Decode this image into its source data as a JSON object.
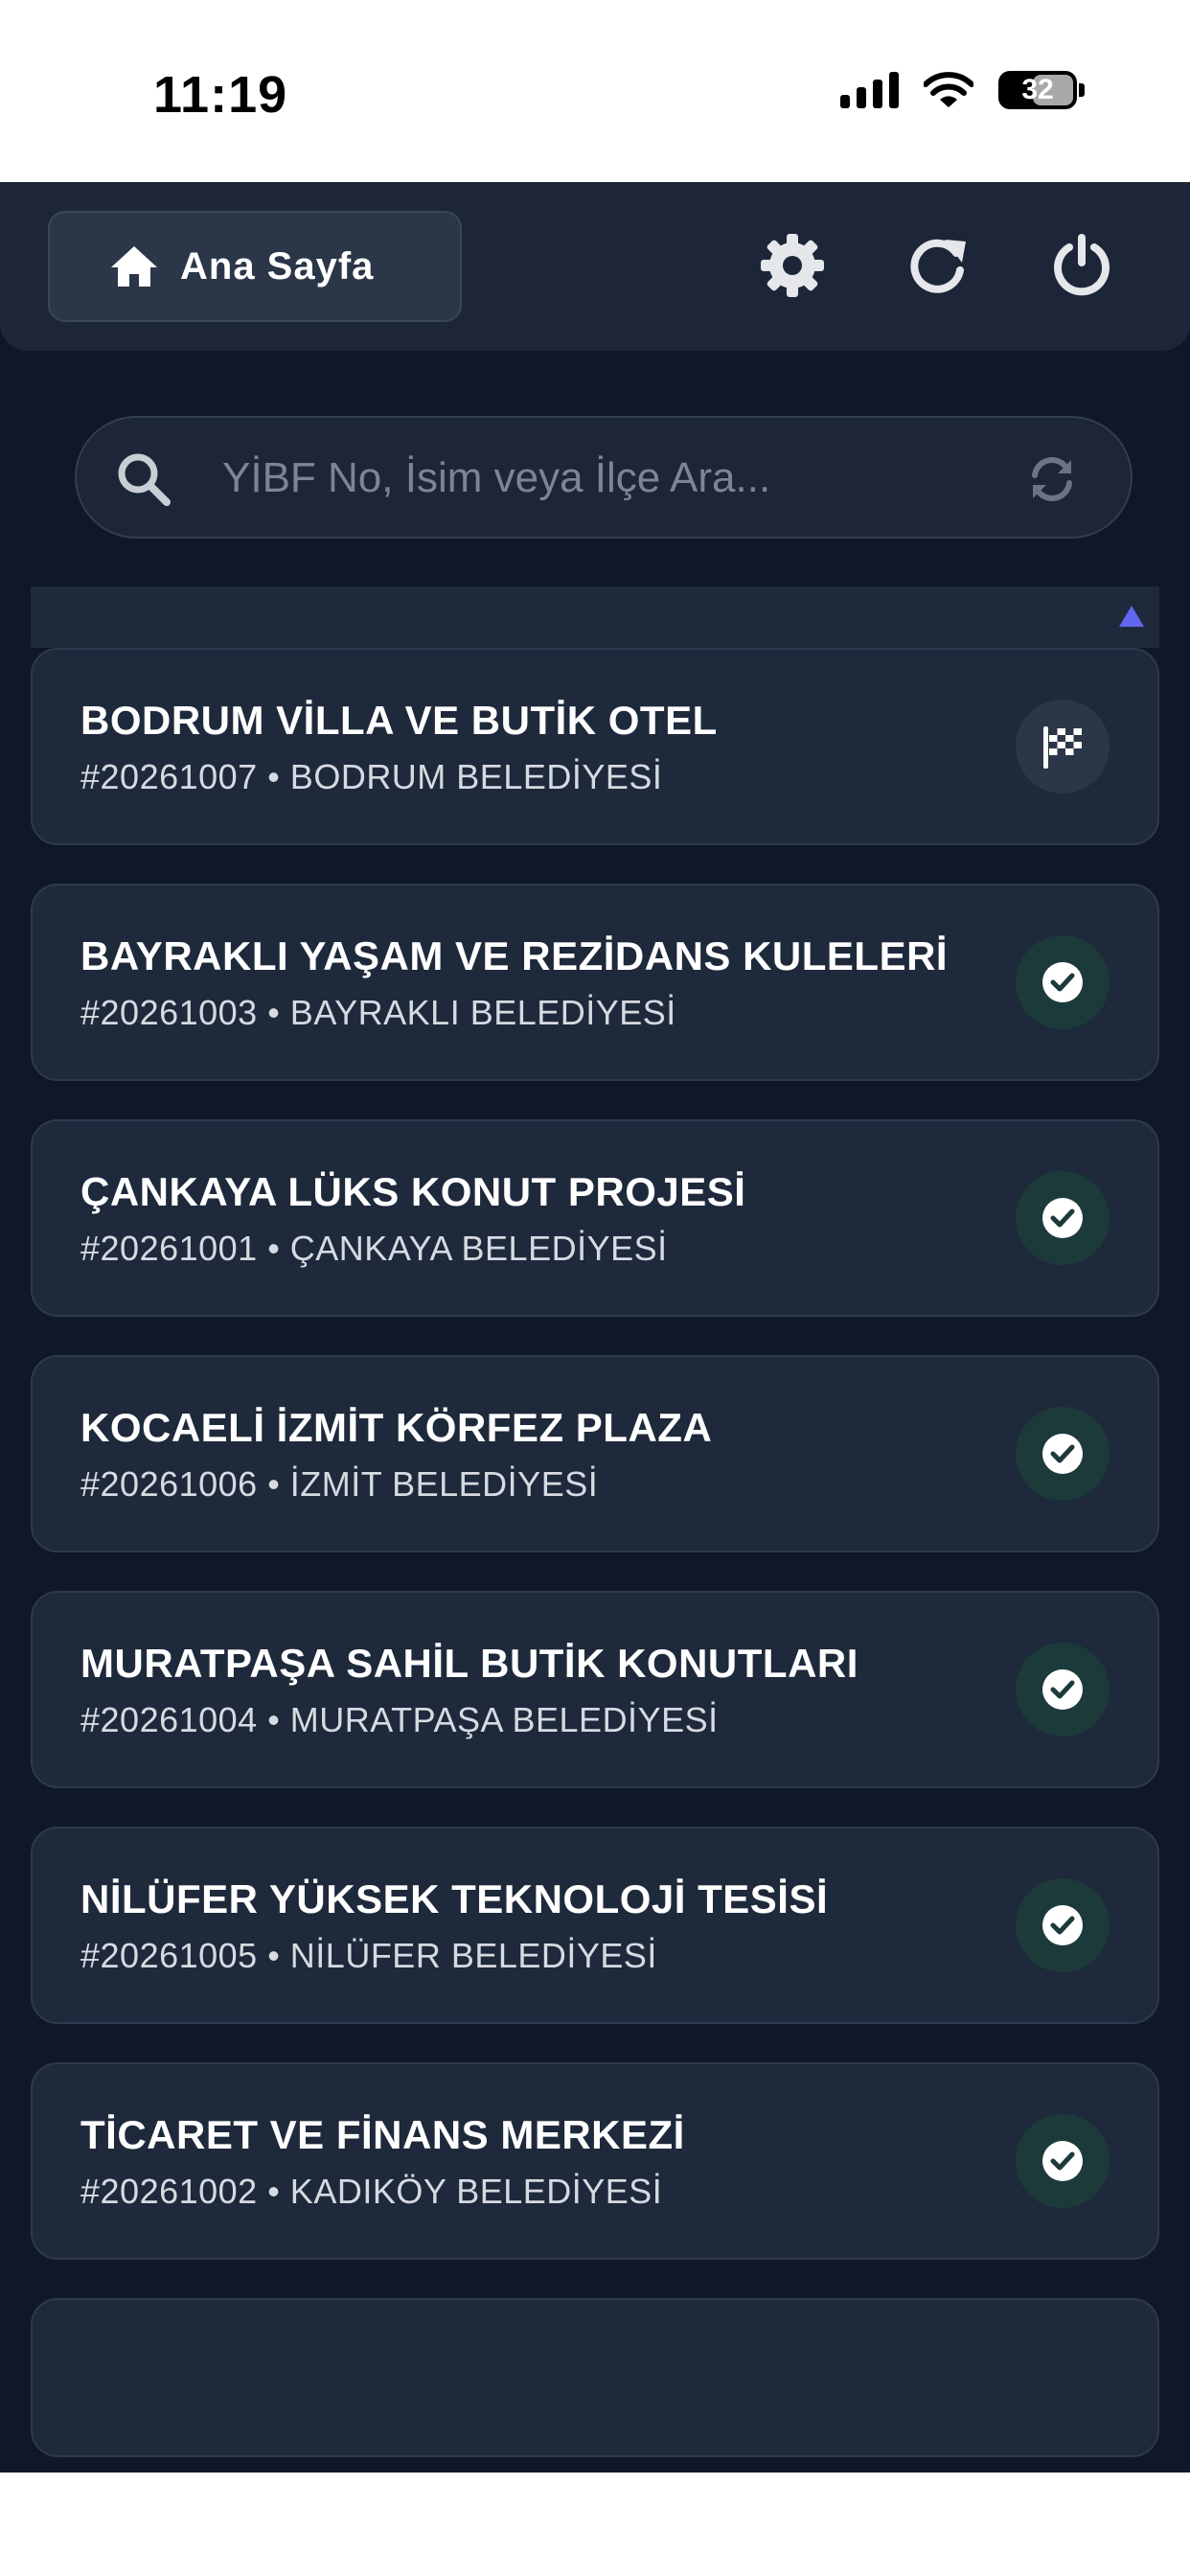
{
  "status_bar": {
    "time": "11:19",
    "battery": "32"
  },
  "topbar": {
    "home_label": "Ana Sayfa",
    "icons": [
      "home-icon",
      "gear-icon",
      "refresh-icon",
      "power-icon"
    ]
  },
  "search": {
    "placeholder": "YİBF No, İsim veya İlçe Ara..."
  },
  "projects": [
    {
      "title": "BODRUM VİLLA VE BUTİK OTEL",
      "subtitle": "#20261007 • BODRUM BELEDİYESİ",
      "status_icon": "checkered-flag-icon"
    },
    {
      "title": "BAYRAKLI YAŞAM VE REZİDANS KULELERİ",
      "subtitle": "#20261003 • BAYRAKLI BELEDİYESİ",
      "status_icon": "check-circle-icon"
    },
    {
      "title": "ÇANKAYA LÜKS KONUT PROJESİ",
      "subtitle": "#20261001 • ÇANKAYA BELEDİYESİ",
      "status_icon": "check-circle-icon"
    },
    {
      "title": "KOCAELİ İZMİT KÖRFEZ PLAZA",
      "subtitle": "#20261006 • İZMİT BELEDİYESİ",
      "status_icon": "check-circle-icon"
    },
    {
      "title": "MURATPAŞA SAHİL BUTİK KONUTLARI",
      "subtitle": "#20261004 • MURATPAŞA BELEDİYESİ",
      "status_icon": "check-circle-icon"
    },
    {
      "title": "NİLÜFER YÜKSEK TEKNOLOJİ TESİSİ",
      "subtitle": "#20261005 • NİLÜFER BELEDİYESİ",
      "status_icon": "check-circle-icon"
    },
    {
      "title": "TİCARET VE FİNANS MERKEZİ",
      "subtitle": "#20261002 • KADIKÖY BELEDİYESİ",
      "status_icon": "check-circle-icon"
    }
  ],
  "colors": {
    "background": "#0f1729",
    "card": "#1e293b",
    "sort_accent": "#6366f1",
    "done_badge": "#1d3a3a"
  }
}
